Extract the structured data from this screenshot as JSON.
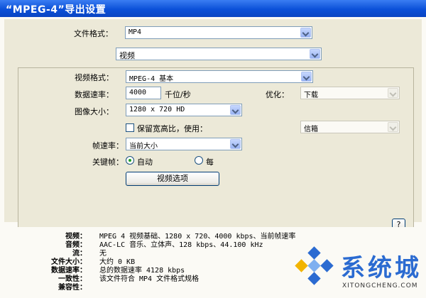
{
  "window": {
    "title": "“MPEG-4”导出设置"
  },
  "colors": {
    "titlebar": "#0b50d8",
    "panel": "#ece9d8",
    "watermark": "#2b6bd1"
  },
  "format": {
    "label": "文件格式：",
    "value": "MP4"
  },
  "section": {
    "value": "视频"
  },
  "video": {
    "format_label": "视频格式：",
    "format_value": "MPEG-4 基本",
    "rate_label": "数据速率：",
    "rate_value": "4000",
    "rate_unit": "千位/秒",
    "optimize_label": "优化：",
    "optimize_value": "下载",
    "size_label": "图像大小：",
    "size_value": "1280 x 720 HD",
    "preserve_label": "保留宽高比，使用：",
    "preserve_value": "信箱",
    "fps_label": "帧速率：",
    "fps_value": "当前大小",
    "keyframe_label": "关键帧：",
    "keyframe_auto": "自动",
    "keyframe_every": "每",
    "options_button": "视频选项",
    "help_button": "?"
  },
  "summary": [
    {
      "key": "视频：",
      "value": "MPEG 4 视频基础、1280 x 720、4000 kbps、当前帧速率"
    },
    {
      "key": "音频：",
      "value": "AAC-LC 音乐、立体声、128 kbps、44.100 kHz"
    },
    {
      "key": "流：",
      "value": "无"
    },
    {
      "key": "文件大小：",
      "value": "大约 0 KB"
    },
    {
      "key": "数据速率：",
      "value": "总的数据速率 4128 kbps"
    },
    {
      "key": "一致性：",
      "value": "该文件符合 MP4 文件格式规格"
    },
    {
      "key": "兼容性：",
      "value": ""
    }
  ],
  "watermark": {
    "text": "系统城",
    "sub": "XITONGCHENG.COM"
  }
}
